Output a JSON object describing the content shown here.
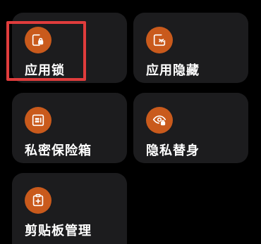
{
  "colors": {
    "background": "#000000",
    "tile": "#1c1c1e",
    "icon_circle": "#c95a1c",
    "label": "#ffffff",
    "highlight": "#e03c3c"
  },
  "tiles": [
    {
      "label": "应用锁",
      "icon": "app-lock-icon"
    },
    {
      "label": "应用隐藏",
      "icon": "app-hide-icon"
    },
    {
      "label": "私密保险箱",
      "icon": "private-safe-icon"
    },
    {
      "label": "隐私替身",
      "icon": "privacy-double-icon"
    },
    {
      "label": "剪贴板管理",
      "icon": "clipboard-icon"
    }
  ]
}
